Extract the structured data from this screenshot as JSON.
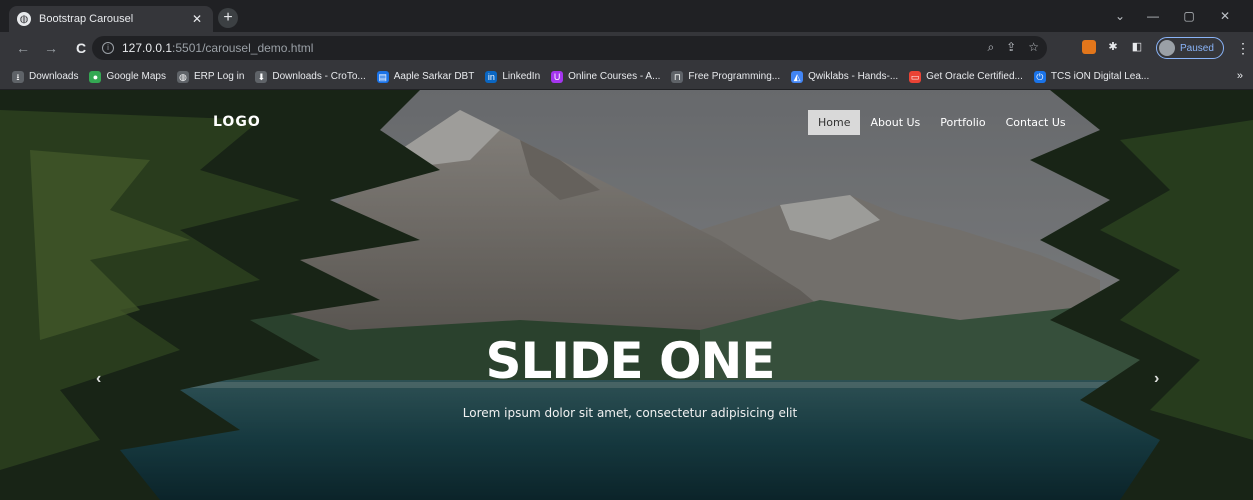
{
  "browser": {
    "tab": {
      "title": "Bootstrap Carousel",
      "close": "✕"
    },
    "new_tab": "+",
    "url": {
      "host": "127.0.0.1",
      "rest": ":5501/carousel_demo.html"
    },
    "profile_status": "Paused",
    "bookmarks": [
      {
        "label": "Downloads",
        "icon": "download-icon",
        "color": "#5f6368",
        "glyph": "⭳"
      },
      {
        "label": "Google Maps",
        "icon": "maps-icon",
        "color": "#34a853",
        "glyph": "●"
      },
      {
        "label": "ERP Log in",
        "icon": "globe-icon",
        "color": "#5f6368",
        "glyph": "◍"
      },
      {
        "label": "Downloads - CroTo...",
        "icon": "download-icon",
        "color": "#5f6368",
        "glyph": "⬇"
      },
      {
        "label": "Aaple Sarkar DBT",
        "icon": "document-icon",
        "color": "#1a73e8",
        "glyph": "▤"
      },
      {
        "label": "LinkedIn",
        "icon": "linkedin-icon",
        "color": "#0a66c2",
        "glyph": "in"
      },
      {
        "label": "Online Courses - A...",
        "icon": "udemy-icon",
        "color": "#a435f0",
        "glyph": "U"
      },
      {
        "label": "Free Programming...",
        "icon": "freecodecamp-icon",
        "color": "#5f6368",
        "glyph": "⊓"
      },
      {
        "label": "Qwiklabs - Hands-...",
        "icon": "qwiklabs-icon",
        "color": "#4285f4",
        "glyph": "◭"
      },
      {
        "label": "Get Oracle Certified...",
        "icon": "oracle-icon",
        "color": "#ea4335",
        "glyph": "▭"
      },
      {
        "label": "TCS iON Digital Lea...",
        "icon": "power-icon",
        "color": "#1a73e8",
        "glyph": "⏻"
      }
    ],
    "bookmarks_more": "»"
  },
  "site": {
    "logo": "LOGO",
    "nav": [
      {
        "label": "Home",
        "active": true
      },
      {
        "label": "About Us",
        "active": false
      },
      {
        "label": "Portfolio",
        "active": false
      },
      {
        "label": "Contact Us",
        "active": false
      }
    ],
    "slide": {
      "title": "SLIDE ONE",
      "caption": "Lorem ipsum dolor sit amet, consectetur adipisicing elit"
    }
  }
}
